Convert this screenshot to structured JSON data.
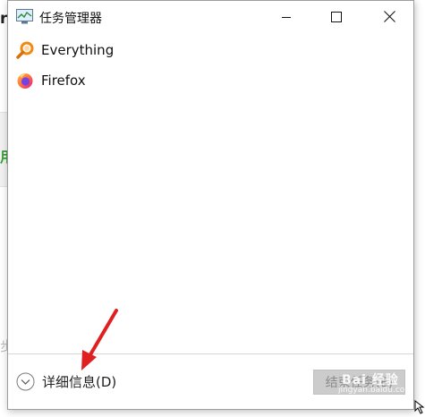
{
  "window": {
    "title": "任务管理器",
    "controls": {
      "minimize_icon": "minimize-icon",
      "maximize_icon": "maximize-icon",
      "close_icon": "close-icon"
    }
  },
  "apps": [
    {
      "label": "Everything",
      "icon": "everything-magnifier-icon"
    },
    {
      "label": "Firefox",
      "icon": "firefox-icon"
    }
  ],
  "footer": {
    "details_label": "详细信息(D)",
    "details_icon": "chevron-down-circle-icon",
    "end_task_label": "结束任务(E)",
    "end_task_enabled": false
  },
  "background": {
    "fragment_top": "r",
    "fragment_green": "用",
    "fragment_bottom": "步"
  },
  "watermark": {
    "main": "Bai 经验",
    "sub": "jingyan.baidu.com"
  },
  "colors": {
    "annotation_arrow": "#e02020",
    "everything_orange": "#f08a12",
    "firefox_orange": "#ff7139",
    "firefox_purple": "#7542e5",
    "disabled_button_bg": "#cccccc"
  }
}
